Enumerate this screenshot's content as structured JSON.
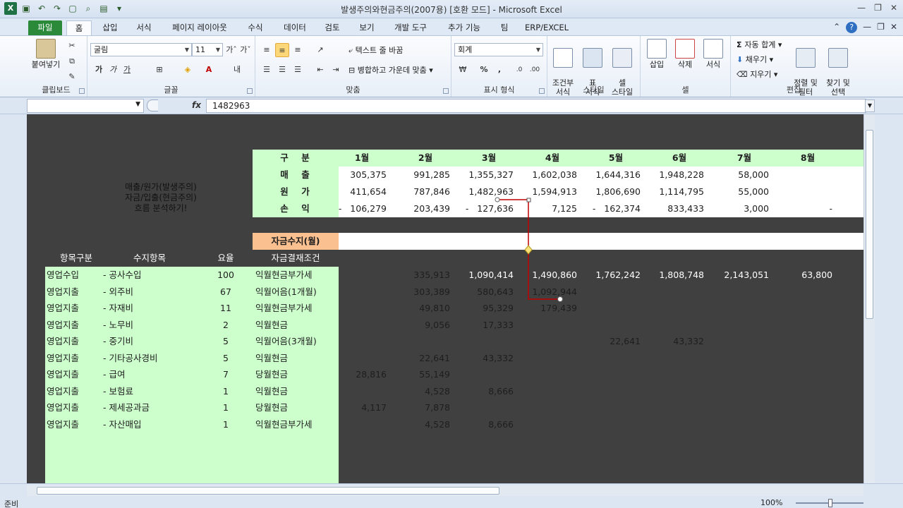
{
  "window": {
    "title": "발생주의와현금주의(2007용)  [호환 모드]  -  Microsoft Excel"
  },
  "tabs": [
    {
      "label": "파일"
    },
    {
      "label": "홈"
    },
    {
      "label": "삽입"
    },
    {
      "label": "서식"
    },
    {
      "label": "페이지 레이아웃"
    },
    {
      "label": "수식"
    },
    {
      "label": "데이터"
    },
    {
      "label": "검토"
    },
    {
      "label": "보기"
    },
    {
      "label": "개발 도구"
    },
    {
      "label": "추가 기능"
    },
    {
      "label": "팀"
    },
    {
      "label": "ERP/EXCEL"
    }
  ],
  "ribbon": {
    "clipboard": {
      "label": "클립보드",
      "paste": "붙여넣기"
    },
    "font": {
      "label": "글꼴",
      "name": "굴림",
      "size": "11",
      "bold": "가",
      "italic": "가",
      "underline": "가"
    },
    "alignment": {
      "label": "맞춤",
      "wrap": "텍스트 줄 바꿈",
      "merge": "병합하고 가운데 맞춤"
    },
    "number": {
      "label": "표시 형식",
      "format": "회계"
    },
    "styles": {
      "label": "스타일",
      "conditional": "조건부\n서식",
      "table": "표\n서식",
      "cell": "셀\n스타일"
    },
    "cells": {
      "label": "셀",
      "insert": "삽입",
      "delete": "삭제",
      "format": "서식"
    },
    "editing": {
      "label": "편집",
      "autosum": "자동 합계",
      "fill": "채우기",
      "clear": "지우기",
      "sort": "정렬 및\n필터",
      "find": "찾기 및\n선택"
    }
  },
  "formula_bar": {
    "value": "1482963",
    "fx": "fx"
  },
  "header_row": {
    "label1": "구",
    "label2": "분",
    "months": [
      "1월",
      "2월",
      "3월",
      "4월",
      "5월",
      "6월",
      "7월",
      "8월"
    ]
  },
  "summary_rows": [
    {
      "label1": "매",
      "label2": "출",
      "values": [
        "305,375",
        "991,285",
        "1,355,327",
        "1,602,038",
        "1,644,316",
        "1,948,228",
        "58,000",
        ""
      ]
    },
    {
      "label1": "원",
      "label2": "가",
      "values": [
        "411,654",
        "787,846",
        "1,482,963",
        "1,594,913",
        "1,806,690",
        "1,114,795",
        "55,000",
        ""
      ]
    },
    {
      "label1": "손",
      "label2": "익",
      "values": [
        "-   106,279",
        "203,439",
        "-   127,636",
        "7,125",
        "-   162,374",
        "833,433",
        "3,000",
        "-"
      ]
    }
  ],
  "note": {
    "line1": "매출/원가(발생주의)",
    "line2": "자금/입출(현금주의)",
    "line3": "흐름 분석하기!"
  },
  "section": {
    "title": "자금수지(월)",
    "cond_header": "자금결재조건"
  },
  "detail_headers": {
    "category": "항목구분",
    "item": "수지항목",
    "rate": "요율"
  },
  "detail_rows": [
    {
      "category": "영업수입",
      "item": "- 공사수입",
      "rate": "100",
      "cond": "익월현금부가세",
      "m1": "",
      "m2": "335,913",
      "m3": "1,090,414",
      "m4": "1,490,860",
      "m5": "1,762,242",
      "m6": "1,808,748",
      "m7": "2,143,051",
      "m8": "63,800"
    },
    {
      "category": "영업지출",
      "item": "- 외주비",
      "rate": "67",
      "cond": "익월어음(1개월)",
      "m1": "",
      "m2": "303,389",
      "m3": "580,643",
      "m4": "1,092,944",
      "m5": "",
      "m6": "",
      "m7": "",
      "m8": ""
    },
    {
      "category": "영업지출",
      "item": "- 자재비",
      "rate": "11",
      "cond": "익월현금부가세",
      "m1": "",
      "m2": "49,810",
      "m3": "95,329",
      "m4": "179,439",
      "m5": "",
      "m6": "",
      "m7": "",
      "m8": ""
    },
    {
      "category": "영업지출",
      "item": "- 노무비",
      "rate": "2",
      "cond": "익월현금",
      "m1": "",
      "m2": "9,056",
      "m3": "17,333",
      "m4": "",
      "m5": "",
      "m6": "",
      "m7": "",
      "m8": ""
    },
    {
      "category": "영업지출",
      "item": "- 중기비",
      "rate": "5",
      "cond": "익월어음(3개월)",
      "m1": "",
      "m2": "",
      "m3": "",
      "m4": "",
      "m5": "22,641",
      "m6": "43,332",
      "m7": "",
      "m8": ""
    },
    {
      "category": "영업지출",
      "item": "- 기타공사경비",
      "rate": "5",
      "cond": "익월현금",
      "m1": "",
      "m2": "22,641",
      "m3": "43,332",
      "m4": "",
      "m5": "",
      "m6": "",
      "m7": "",
      "m8": ""
    },
    {
      "category": "영업지출",
      "item": "- 급여",
      "rate": "7",
      "cond": "당월현금",
      "m1": "28,816",
      "m2": "55,149",
      "m3": "",
      "m4": "",
      "m5": "",
      "m6": "",
      "m7": "",
      "m8": ""
    },
    {
      "category": "영업지출",
      "item": "- 보험료",
      "rate": "1",
      "cond": "익월현금",
      "m1": "",
      "m2": "4,528",
      "m3": "8,666",
      "m4": "",
      "m5": "",
      "m6": "",
      "m7": "",
      "m8": ""
    },
    {
      "category": "영업지출",
      "item": "- 제세공과금",
      "rate": "1",
      "cond": "당월현금",
      "m1": "4,117",
      "m2": "7,878",
      "m3": "",
      "m4": "",
      "m5": "",
      "m6": "",
      "m7": "",
      "m8": ""
    },
    {
      "category": "영업지출",
      "item": "- 자산매입",
      "rate": "1",
      "cond": "익월현금부가세",
      "m1": "",
      "m2": "4,528",
      "m3": "8,666",
      "m4": "",
      "m5": "",
      "m6": "",
      "m7": "",
      "m8": ""
    }
  ],
  "status": {
    "ready": "준비",
    "zoom": "100%"
  },
  "colors": {
    "green_fill": "#ccffcc",
    "orange_fill": "#fac090",
    "dark_bg": "#404040",
    "arrow": "#c00000"
  }
}
